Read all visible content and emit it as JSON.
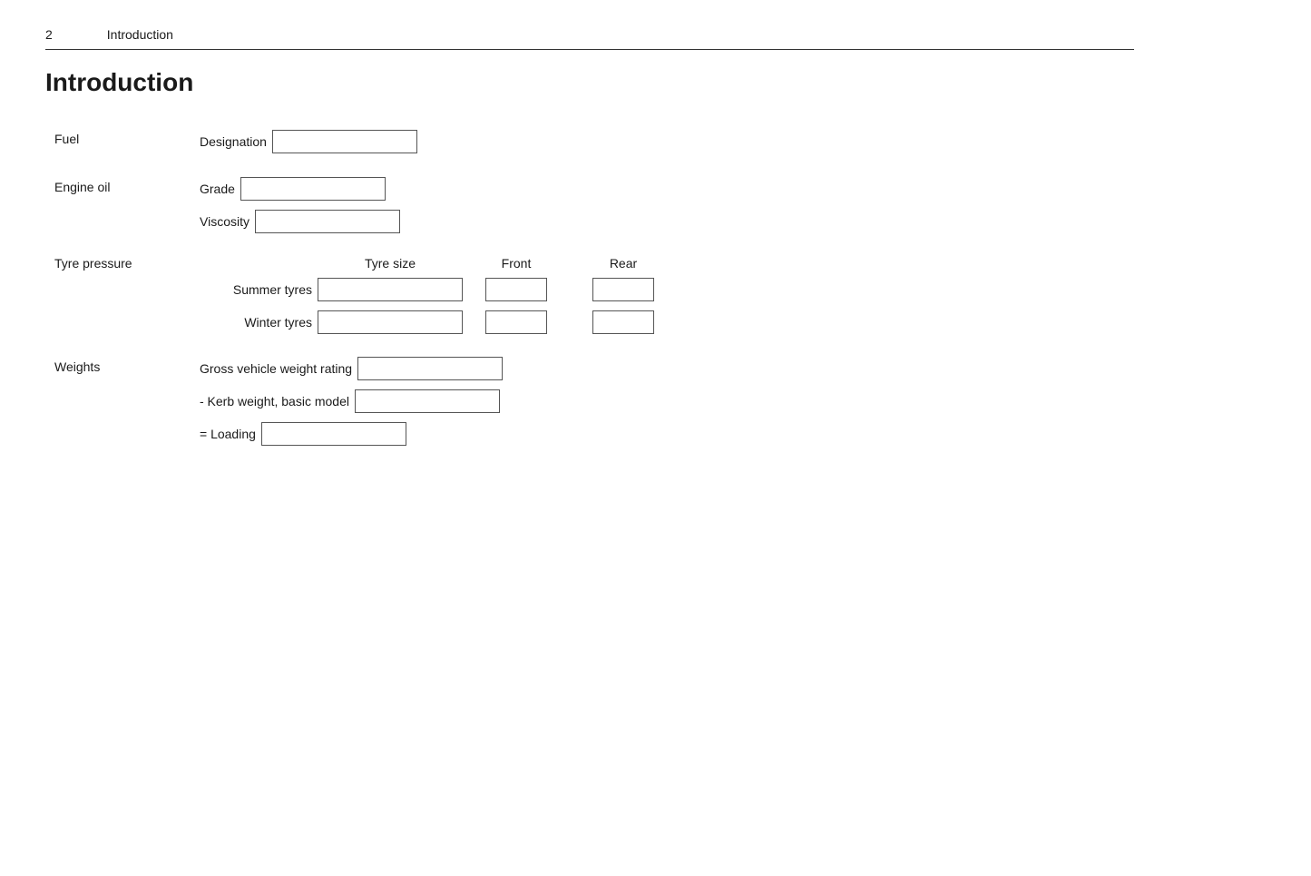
{
  "header": {
    "page_number": "2",
    "title": "Introduction"
  },
  "main_title": "Introduction",
  "fuel": {
    "section_label": "Fuel",
    "designation_label": "Designation"
  },
  "engine_oil": {
    "section_label": "Engine oil",
    "grade_label": "Grade",
    "viscosity_label": "Viscosity"
  },
  "tyre_pressure": {
    "section_label": "Tyre pressure",
    "tyre_size_header": "Tyre size",
    "front_header": "Front",
    "rear_header": "Rear",
    "summer_label": "Summer tyres",
    "winter_label": "Winter tyres"
  },
  "weights": {
    "section_label": "Weights",
    "gross_label": "Gross vehicle weight rating",
    "kerb_label": "- Kerb weight, basic model",
    "loading_label": "= Loading"
  }
}
